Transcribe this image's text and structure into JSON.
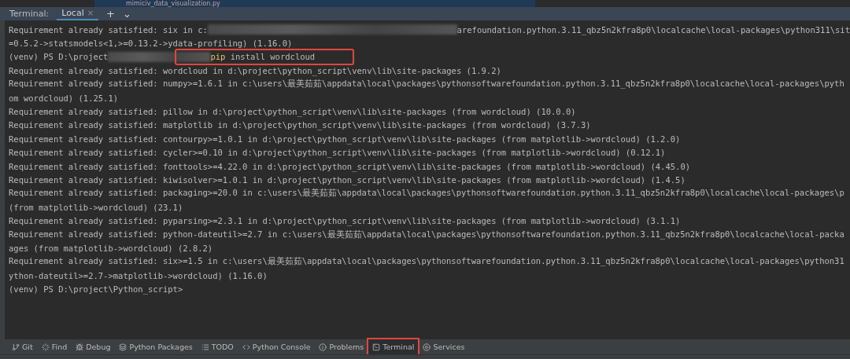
{
  "editor_tab": {
    "label": "mimiciv_data_visualization.py"
  },
  "terminal_header": {
    "title": "Terminal:",
    "tabs": [
      {
        "label": "Local",
        "selected": true,
        "close": "×"
      }
    ],
    "add": "+",
    "menu": "⌄"
  },
  "terminal_lines": [
    [
      {
        "kind": "plain",
        "text": "Requirement already satisfied: six in c:"
      },
      {
        "kind": "redacted"
      },
      {
        "kind": "plain",
        "text": "arefoundation.python.3.11_qbz5n2kfra8p0\\localcache\\local-packages\\python311\\sit"
      }
    ],
    [
      {
        "kind": "plain",
        "text": "=0.5.2->statsmodels<1,>=0.13.2->ydata-profiling) (1.16.0)"
      }
    ],
    [
      {
        "kind": "plain",
        "text": "(venv) PS D:\\project"
      },
      {
        "kind": "redacted"
      },
      {
        "kind": "command",
        "text": "pip"
      },
      {
        "kind": "plain",
        "text": " install wordcloud"
      }
    ],
    [
      {
        "kind": "plain",
        "text": "Requirement already satisfied: wordcloud in d:\\project\\python_script\\venv\\lib\\site-packages (1.9.2)"
      }
    ],
    [
      {
        "kind": "plain",
        "text": "Requirement already satisfied: numpy>=1.6.1 in c:\\users\\最美茹茹\\appdata\\local\\packages\\pythonsoftwarefoundation.python.3.11_qbz5n2kfra8p0\\localcache\\local-packages\\pyth"
      }
    ],
    [
      {
        "kind": "plain",
        "text": "om wordcloud) (1.25.1)"
      }
    ],
    [
      {
        "kind": "plain",
        "text": "Requirement already satisfied: pillow in d:\\project\\python_script\\venv\\lib\\site-packages (from wordcloud) (10.0.0)"
      }
    ],
    [
      {
        "kind": "plain",
        "text": "Requirement already satisfied: matplotlib in d:\\project\\python_script\\venv\\lib\\site-packages (from wordcloud) (3.7.3)"
      }
    ],
    [
      {
        "kind": "plain",
        "text": "Requirement already satisfied: contourpy>=1.0.1 in d:\\project\\python_script\\venv\\lib\\site-packages (from matplotlib->wordcloud) (1.2.0)"
      }
    ],
    [
      {
        "kind": "plain",
        "text": "Requirement already satisfied: cycler>=0.10 in d:\\project\\python_script\\venv\\lib\\site-packages (from matplotlib->wordcloud) (0.12.1)"
      }
    ],
    [
      {
        "kind": "plain",
        "text": "Requirement already satisfied: fonttools>=4.22.0 in d:\\project\\python_script\\venv\\lib\\site-packages (from matplotlib->wordcloud) (4.45.0)"
      }
    ],
    [
      {
        "kind": "plain",
        "text": "Requirement already satisfied: kiwisolver>=1.0.1 in d:\\project\\python_script\\venv\\lib\\site-packages (from matplotlib->wordcloud) (1.4.5)"
      }
    ],
    [
      {
        "kind": "plain",
        "text": "Requirement already satisfied: packaging>=20.0 in c:\\users\\最美茹茹\\appdata\\local\\packages\\pythonsoftwarefoundation.python.3.11_qbz5n2kfra8p0\\localcache\\local-packages\\p"
      }
    ],
    [
      {
        "kind": "plain",
        "text": "(from matplotlib->wordcloud) (23.1)"
      }
    ],
    [
      {
        "kind": "plain",
        "text": "Requirement already satisfied: pyparsing>=2.3.1 in d:\\project\\python_script\\venv\\lib\\site-packages (from matplotlib->wordcloud) (3.1.1)"
      }
    ],
    [
      {
        "kind": "plain",
        "text": "Requirement already satisfied: python-dateutil>=2.7 in c:\\users\\最美茹茹\\appdata\\local\\packages\\pythonsoftwarefoundation.python.3.11_qbz5n2kfra8p0\\localcache\\local-packa"
      }
    ],
    [
      {
        "kind": "plain",
        "text": "ages (from matplotlib->wordcloud) (2.8.2)"
      }
    ],
    [
      {
        "kind": "plain",
        "text": "Requirement already satisfied: six>=1.5 in c:\\users\\最美茹茹\\appdata\\local\\packages\\pythonsoftwarefoundation.python.3.11_qbz5n2kfra8p0\\localcache\\local-packages\\python31"
      }
    ],
    [
      {
        "kind": "plain",
        "text": "ython-dateutil>=2.7->matplotlib->wordcloud) (1.16.0)"
      }
    ],
    [
      {
        "kind": "plain",
        "text": "(venv) PS D:\\project\\Python_script>"
      }
    ]
  ],
  "tool_windows": [
    {
      "label": "Git",
      "selected": false,
      "highlighted": false
    },
    {
      "label": "Find",
      "selected": false,
      "highlighted": false
    },
    {
      "label": "Debug",
      "selected": false,
      "highlighted": false
    },
    {
      "label": "Python Packages",
      "selected": false,
      "highlighted": false
    },
    {
      "label": "TODO",
      "selected": false,
      "highlighted": false
    },
    {
      "label": "Python Console",
      "selected": false,
      "highlighted": false
    },
    {
      "label": "Problems",
      "selected": false,
      "highlighted": false
    },
    {
      "label": "Terminal",
      "selected": true,
      "highlighted": true
    },
    {
      "label": "Services",
      "selected": false,
      "highlighted": false
    }
  ]
}
